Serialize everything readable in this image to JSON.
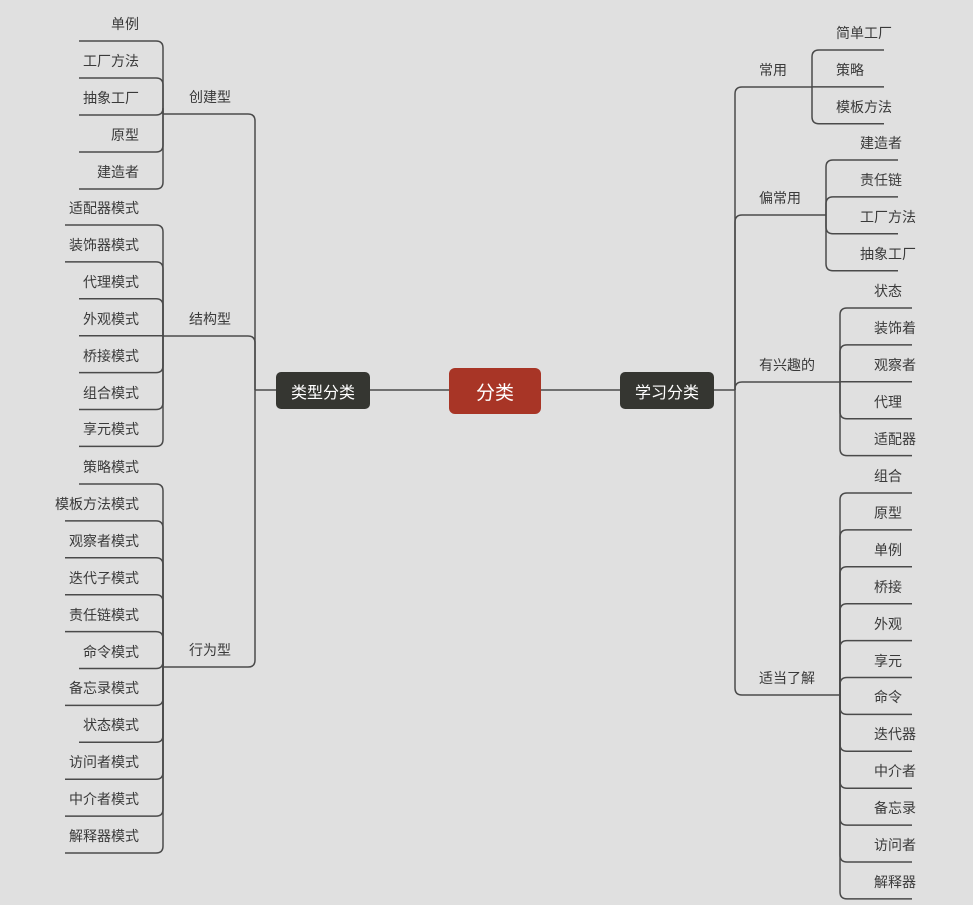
{
  "colors": {
    "background": "#e0e0e0",
    "line": "#4a4a4a",
    "root_fill": "#a83526",
    "branch_fill": "#353631"
  },
  "root": "分类",
  "left": {
    "label": "类型分类",
    "groups": [
      {
        "label": "创建型",
        "items": [
          "单例",
          "工厂方法",
          "抽象工厂",
          "原型",
          "建造者"
        ]
      },
      {
        "label": "结构型",
        "items": [
          "适配器模式",
          "装饰器模式",
          "代理模式",
          "外观模式",
          "桥接模式",
          "组合模式",
          "享元模式"
        ]
      },
      {
        "label": "行为型",
        "items": [
          "策略模式",
          "模板方法模式",
          "观察者模式",
          "迭代子模式",
          "责任链模式",
          "命令模式",
          "备忘录模式",
          "状态模式",
          "访问者模式",
          "中介者模式",
          "解释器模式"
        ]
      }
    ]
  },
  "right": {
    "label": "学习分类",
    "groups": [
      {
        "label": "常用",
        "items": [
          "简单工厂",
          "策略",
          "模板方法"
        ]
      },
      {
        "label": "偏常用",
        "items": [
          "建造者",
          "责任链",
          "工厂方法",
          "抽象工厂"
        ]
      },
      {
        "label": "有兴趣的",
        "items": [
          "状态",
          "装饰着",
          "观察者",
          "代理",
          "适配器"
        ]
      },
      {
        "label": "适当了解",
        "items": [
          "组合",
          "原型",
          "单例",
          "桥接",
          "外观",
          "享元",
          "命令",
          "迭代器",
          "中介者",
          "备忘录",
          "访问者",
          "解释器"
        ]
      }
    ]
  }
}
